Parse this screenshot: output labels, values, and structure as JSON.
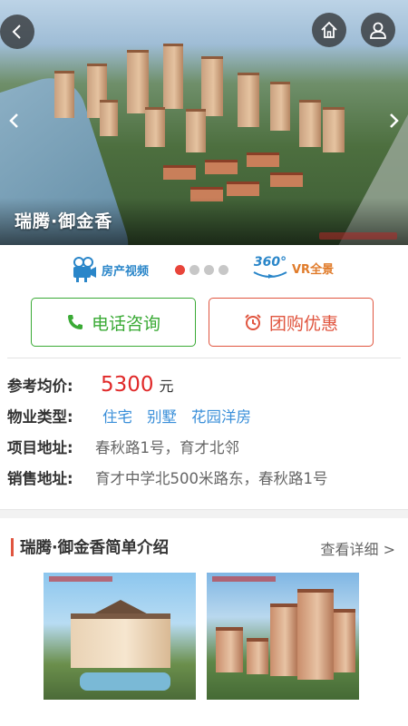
{
  "hero": {
    "title": "瑞腾·御金香",
    "back_icon": "chevron-left-icon",
    "home_icon": "home-icon",
    "user_icon": "user-icon",
    "prev_icon": "chevron-left-icon",
    "next_icon": "chevron-right-icon",
    "carousel": {
      "total": 4,
      "active": 1
    }
  },
  "media": {
    "video_label": "房产视频",
    "vr_badge": "360°",
    "vr_label": "VR全景"
  },
  "actions": {
    "call_label": "电话咨询",
    "group_label": "团购优惠",
    "call_color": "#3aaa35",
    "group_color": "#e0553f"
  },
  "info": {
    "price_label": "参考均价:",
    "price_value": "5300",
    "price_unit": "元",
    "type_label": "物业类型:",
    "types": [
      "住宅",
      "别墅",
      "花园洋房"
    ],
    "address_label": "项目地址:",
    "address_value": "春秋路1号，育才北邻",
    "sales_label": "销售地址:",
    "sales_value": "育才中学北500米路东，春秋路1号"
  },
  "intro": {
    "title": "瑞腾·御金香简单介绍",
    "more_label": "查看详细 >"
  },
  "colors": {
    "accent_red": "#e02828",
    "tag_blue": "#3a8fd9"
  }
}
